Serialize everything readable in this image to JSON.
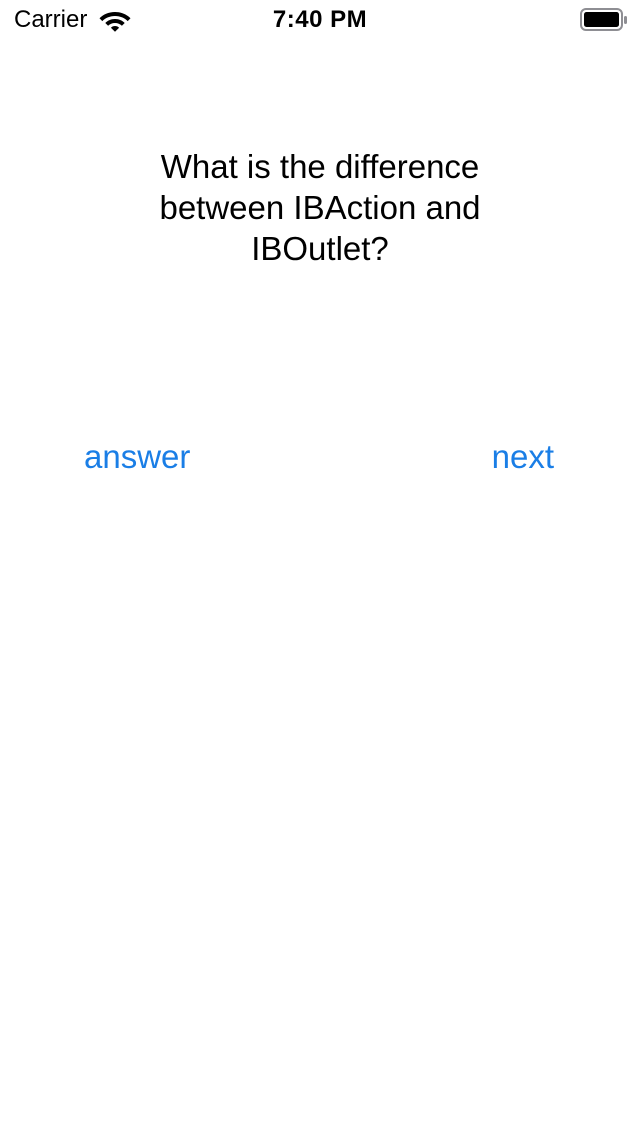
{
  "status_bar": {
    "carrier": "Carrier",
    "time": "7:40 PM",
    "icons": [
      "wifi-icon",
      "battery-icon"
    ]
  },
  "card": {
    "question": "What is the difference between IBAction and IBOutlet?"
  },
  "buttons": {
    "answer_label": "answer",
    "next_label": "next"
  },
  "colors": {
    "background": "#ffffff",
    "text": "#000000",
    "accent": "#1a7ee6"
  }
}
